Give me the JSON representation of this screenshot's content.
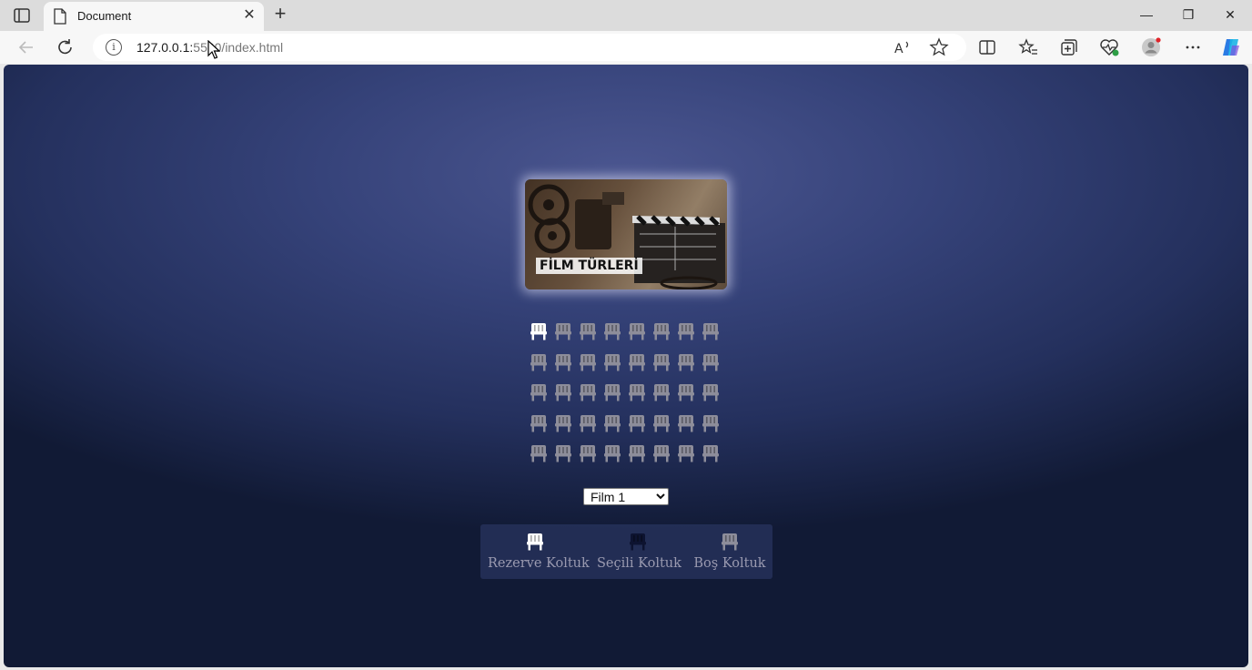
{
  "browser": {
    "tab_title": "Document",
    "tab_close_glyph": "✕",
    "new_tab_glyph": "+",
    "url_host": "127.0.0.1:",
    "url_rest": "5500/index.html",
    "window_controls": {
      "minimize": "—",
      "restore": "❐",
      "close": "✕"
    },
    "toolbar_icons": [
      "back-icon",
      "refresh-icon",
      "read-aloud-icon",
      "favorite-star-icon",
      "split-screen-icon",
      "favorites-icon",
      "collections-icon",
      "browser-essentials-icon",
      "profile-icon",
      "more-icon",
      "copilot-icon"
    ]
  },
  "page": {
    "poster_text": "FİLM TÜRLERİ",
    "seat_rows": [
      [
        "selected",
        "empty",
        "empty",
        "empty",
        "empty",
        "empty",
        "empty",
        "empty"
      ],
      [
        "empty",
        "empty",
        "empty",
        "empty",
        "empty",
        "empty",
        "empty",
        "empty"
      ],
      [
        "empty",
        "empty",
        "empty",
        "empty",
        "empty",
        "empty",
        "empty",
        "empty"
      ],
      [
        "empty",
        "empty",
        "empty",
        "empty",
        "empty",
        "empty",
        "empty",
        "empty"
      ],
      [
        "empty",
        "empty",
        "empty",
        "empty",
        "empty",
        "empty",
        "empty",
        "empty"
      ]
    ],
    "movie_select": {
      "selected": "Film 1",
      "options": [
        "Film 1"
      ]
    },
    "legend": [
      {
        "label": "Rezerve Koltuk",
        "state": "reserved"
      },
      {
        "label": "Seçili Koltuk",
        "state": "selected-dark"
      },
      {
        "label": "Boş Koltuk",
        "state": "empty"
      }
    ],
    "colors": {
      "seat_empty": "#8d8d9a",
      "seat_highlight": "#ffffff",
      "seat_dark": "#0d1330",
      "background_top": "#4b5690",
      "background_bottom": "#111a35"
    }
  }
}
